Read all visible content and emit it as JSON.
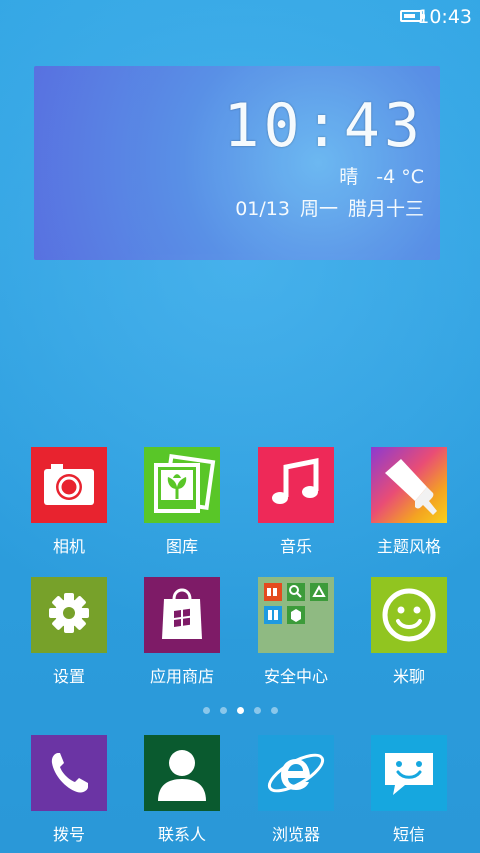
{
  "status": {
    "time": "10:43",
    "battery_level": 0.75
  },
  "widget": {
    "clock": "10:43",
    "weather": "晴",
    "temperature": "-4 °C",
    "date": "01/13",
    "weekday": "周一",
    "lunar": "腊月十三"
  },
  "apps": [
    {
      "label": "相机",
      "icon": "camera-icon",
      "color": "#e8232f"
    },
    {
      "label": "图库",
      "icon": "gallery-icon",
      "color": "#59c628"
    },
    {
      "label": "音乐",
      "icon": "music-note-icon",
      "color": "#ee2958"
    },
    {
      "label": "主题风格",
      "icon": "paint-brush-icon",
      "color": "#e94d75"
    },
    {
      "label": "设置",
      "icon": "gear-icon",
      "color": "#77a12a"
    },
    {
      "label": "应用商店",
      "icon": "shopping-bag-icon",
      "color": "#7e1b67"
    },
    {
      "label": "安全中心",
      "icon": "security-folder-icon",
      "color": "#8fba82"
    },
    {
      "label": "米聊",
      "icon": "smiley-icon",
      "color": "#91c520"
    }
  ],
  "page_indicator": {
    "total": 5,
    "current": 3
  },
  "dock": [
    {
      "label": "拨号",
      "icon": "phone-icon",
      "color": "#6b34a4"
    },
    {
      "label": "联系人",
      "icon": "contact-icon",
      "color": "#0a5a2f"
    },
    {
      "label": "浏览器",
      "icon": "browser-icon",
      "color": "#1e9fdc"
    },
    {
      "label": "短信",
      "icon": "message-icon",
      "color": "#16a7df"
    }
  ]
}
